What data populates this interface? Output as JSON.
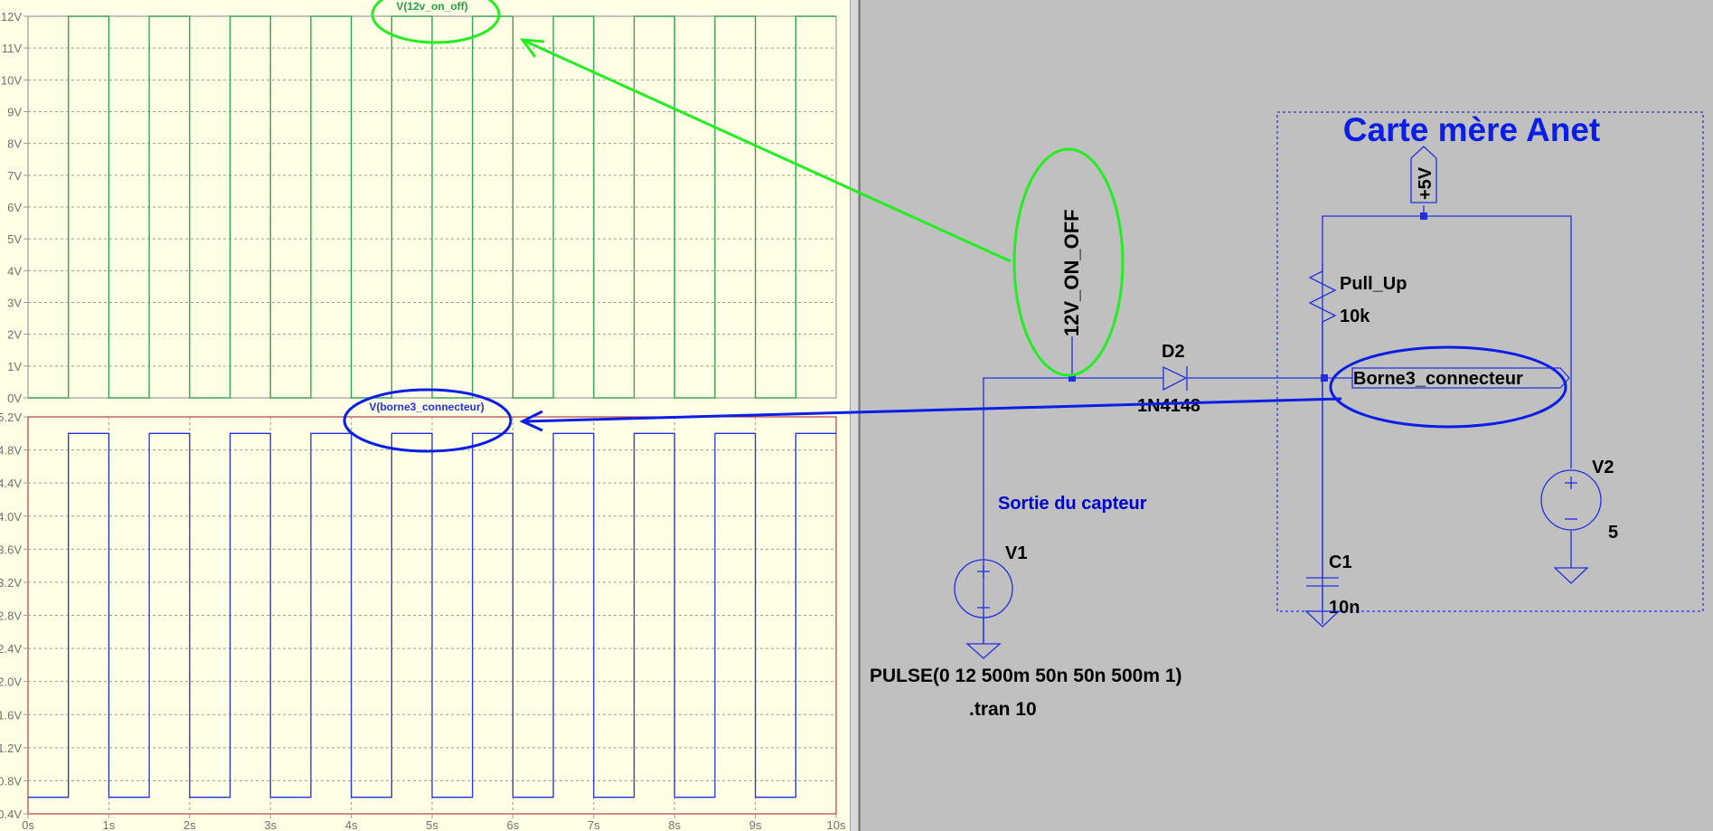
{
  "waveform": {
    "top": {
      "trace_label": "V(12v_on_off)",
      "y_ticks": [
        "0V",
        "1V",
        "2V",
        "3V",
        "4V",
        "5V",
        "6V",
        "7V",
        "8V",
        "9V",
        "10V",
        "11V",
        "12V"
      ],
      "color": "#22a14a"
    },
    "bottom": {
      "trace_label": "V(borne3_connecteur)",
      "y_ticks": [
        "0.4V",
        "0.8V",
        "1.2V",
        "1.6V",
        "2.0V",
        "2.4V",
        "2.8V",
        "3.2V",
        "3.6V",
        "4.0V",
        "4.4V",
        "4.8V",
        "5.2V"
      ],
      "color": "#2030e0"
    },
    "x_ticks": [
      "0s",
      "1s",
      "2s",
      "3s",
      "4s",
      "5s",
      "6s",
      "7s",
      "8s",
      "9s",
      "10s"
    ]
  },
  "chart_data": [
    {
      "type": "line",
      "title": "V(12v_on_off)",
      "xlabel": "",
      "ylabel": "",
      "xlim": [
        0,
        10
      ],
      "ylim": [
        0,
        12
      ],
      "grid": true,
      "series": [
        {
          "name": "V(12v_on_off)",
          "x": [
            0,
            0.5,
            0.5,
            1,
            1,
            1.5,
            1.5,
            2,
            2,
            2.5,
            2.5,
            3,
            3,
            3.5,
            3.5,
            4,
            4,
            4.5,
            4.5,
            5,
            5,
            5.5,
            5.5,
            6,
            6,
            6.5,
            6.5,
            7,
            7,
            7.5,
            7.5,
            8,
            8,
            8.5,
            8.5,
            9,
            9,
            9.5,
            9.5,
            10
          ],
          "y": [
            0,
            0,
            12,
            12,
            0,
            0,
            12,
            12,
            0,
            0,
            12,
            12,
            0,
            0,
            12,
            12,
            0,
            0,
            12,
            12,
            0,
            0,
            12,
            12,
            0,
            0,
            12,
            12,
            0,
            0,
            12,
            12,
            0,
            0,
            12,
            12,
            0,
            0,
            12,
            12
          ]
        }
      ]
    },
    {
      "type": "line",
      "title": "V(borne3_connecteur)",
      "xlabel": "",
      "ylabel": "",
      "xlim": [
        0,
        10
      ],
      "ylim": [
        0.4,
        5.2
      ],
      "grid": true,
      "series": [
        {
          "name": "V(borne3_connecteur)",
          "x": [
            0,
            0.5,
            0.5,
            1,
            1,
            1.5,
            1.5,
            2,
            2,
            2.5,
            2.5,
            3,
            3,
            3.5,
            3.5,
            4,
            4,
            4.5,
            4.5,
            5,
            5,
            5.5,
            5.5,
            6,
            6,
            6.5,
            6.5,
            7,
            7,
            7.5,
            7.5,
            8,
            8,
            8.5,
            8.5,
            9,
            9,
            9.5,
            9.5,
            10
          ],
          "y": [
            0.6,
            0.6,
            5.0,
            5.0,
            0.6,
            0.6,
            5.0,
            5.0,
            0.6,
            0.6,
            5.0,
            5.0,
            0.6,
            0.6,
            5.0,
            5.0,
            0.6,
            0.6,
            5.0,
            5.0,
            0.6,
            0.6,
            5.0,
            5.0,
            0.6,
            0.6,
            5.0,
            5.0,
            0.6,
            0.6,
            5.0,
            5.0,
            0.6,
            0.6,
            5.0,
            5.0,
            0.6,
            0.6,
            5.0,
            5.0
          ]
        }
      ]
    }
  ],
  "schematic": {
    "title": "Carte mère Anet",
    "net_12v": "12V_ON_OFF",
    "d2_name": "D2",
    "d2_model": "1N4148",
    "net_borne3": "Borne3_connecteur",
    "sortie_label": "Sortie du capteur",
    "v1_name": "V1",
    "v1_value": "PULSE(0 12 500m 50n 50n 500m 1)",
    "tran": ".tran 10",
    "pullup_name": "Pull_Up",
    "pullup_value": "10k",
    "c1_name": "C1",
    "c1_value": "10n",
    "v2_name": "V2",
    "v2_value": "5",
    "plus5v": "+5V",
    "colors": {
      "wire": "#2030e0",
      "annotation_green": "#22ee22",
      "annotation_blue": "#0a1ee6",
      "text_blue": "#0000cc"
    }
  }
}
